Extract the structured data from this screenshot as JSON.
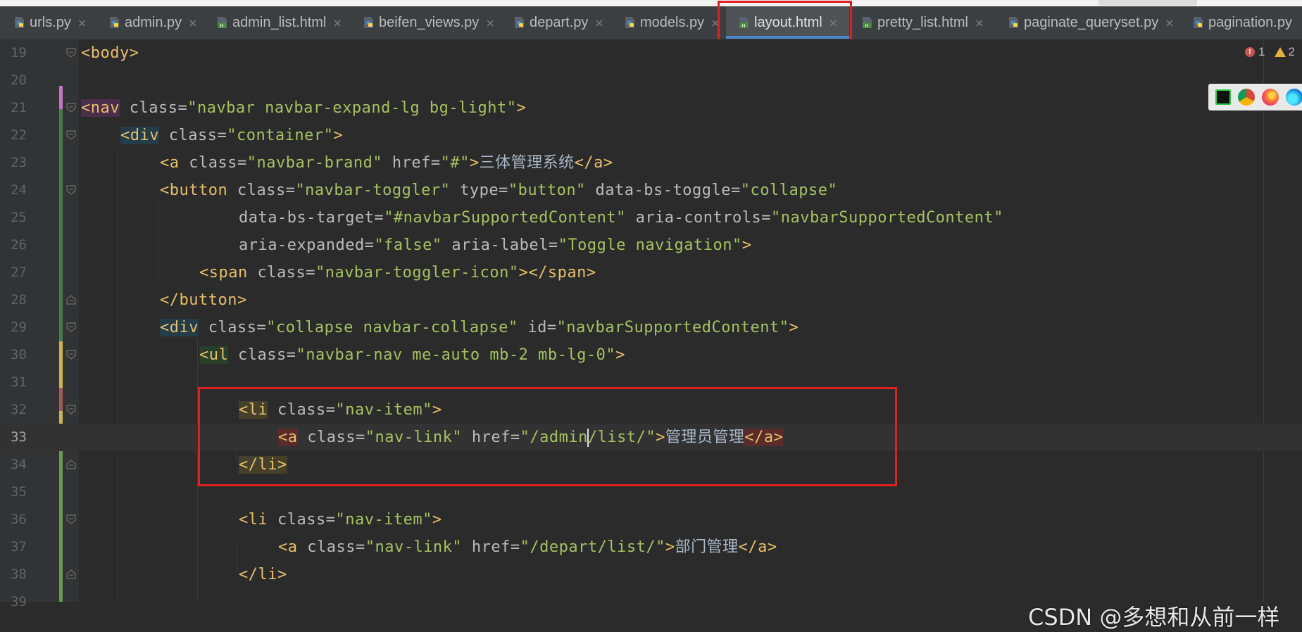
{
  "tabs": [
    {
      "label": "urls.py",
      "type": "py"
    },
    {
      "label": "admin.py",
      "type": "py"
    },
    {
      "label": "admin_list.html",
      "type": "html"
    },
    {
      "label": "beifen_views.py",
      "type": "py"
    },
    {
      "label": "depart.py",
      "type": "py"
    },
    {
      "label": "models.py",
      "type": "py"
    },
    {
      "label": "layout.html",
      "type": "html",
      "active": true
    },
    {
      "label": "pretty_list.html",
      "type": "html"
    },
    {
      "label": "paginate_queryset.py",
      "type": "py"
    },
    {
      "label": "pagination.py",
      "type": "py"
    }
  ],
  "tab_close_glyph": "×",
  "inspection": {
    "errors": "1",
    "warnings": "2"
  },
  "line_numbers": [
    "19",
    "20",
    "21",
    "22",
    "23",
    "24",
    "25",
    "26",
    "27",
    "28",
    "29",
    "30",
    "31",
    "32",
    "33",
    "34",
    "35",
    "36",
    "37",
    "38",
    "39"
  ],
  "current_line": "33",
  "code": {
    "l19": {
      "t1": "<body>"
    },
    "l21": {
      "t1": "<nav",
      "a1": " class=",
      "s1": "\"navbar navbar-expand-lg bg-light\"",
      "t2": ">"
    },
    "l22": {
      "t1": "<div",
      "a1": " class=",
      "s1": "\"container\"",
      "t2": ">"
    },
    "l23": {
      "t1": "<a",
      "a1": " class=",
      "s1": "\"navbar-brand\"",
      "a2": " href=",
      "s2": "\"#\"",
      "t2": ">",
      "x1": "三体管理系统",
      "t3": "</a>"
    },
    "l24": {
      "t1": "<button",
      "a1": " class=",
      "s1": "\"navbar-toggler\"",
      "a2": " type=",
      "s2": "\"button\"",
      "a3": " data-bs-toggle=",
      "s3": "\"collapse\""
    },
    "l25": {
      "a1": "data-bs-target=",
      "s1": "\"#navbarSupportedContent\"",
      "a2": " aria-controls=",
      "s2": "\"navbarSupportedContent\""
    },
    "l26": {
      "a1": "aria-expanded=",
      "s1": "\"false\"",
      "a2": " aria-label=",
      "s2": "\"Toggle navigation\"",
      "t1": ">"
    },
    "l27": {
      "t1": "<span",
      "a1": " class=",
      "s1": "\"navbar-toggler-icon\"",
      "t2": "></span>"
    },
    "l28": {
      "t1": "</button>"
    },
    "l29": {
      "t1": "<div",
      "a1": " class=",
      "s1": "\"collapse navbar-collapse\"",
      "a2": " id=",
      "s2": "\"navbarSupportedContent\"",
      "t2": ">"
    },
    "l30": {
      "t1": "<ul",
      "a1": " class=",
      "s1": "\"navbar-nav me-auto mb-2 mb-lg-0\"",
      "t2": ">"
    },
    "l32": {
      "t1": "<li",
      "a1": " class=",
      "s1": "\"nav-item\"",
      "t2": ">"
    },
    "l33": {
      "t1": "<a",
      "a1": " class=",
      "s1": "\"nav-link\"",
      "a2": " href=",
      "s2a": "\"/admin",
      "s2b": "/list/\"",
      "t2": ">",
      "x1": "管理员管理",
      "t3": "</a>"
    },
    "l34": {
      "t1": "</li>"
    },
    "l36": {
      "t1": "<li",
      "a1": " class=",
      "s1": "\"nav-item\"",
      "t2": ">"
    },
    "l37": {
      "t1": "<a",
      "a1": " class=",
      "s1": "\"nav-link\"",
      "a2": " href=",
      "s2": "\"/depart/list/\"",
      "t2": ">",
      "x1": "部门管理",
      "t3": "</a>"
    },
    "l38": {
      "t1": "</li>"
    }
  },
  "watermark": "CSDN @多想和从前一样",
  "colors": {
    "tag": "#e8bf6a",
    "attr": "#bababa",
    "string": "#a5c261",
    "highlight": "#e02020",
    "accent": "#4a88c7"
  }
}
